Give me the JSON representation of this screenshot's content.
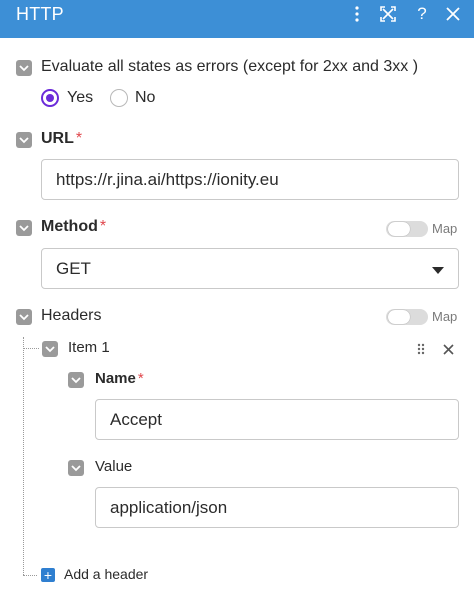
{
  "header": {
    "title": "HTTP",
    "icons": [
      "more-vert-icon",
      "fullscreen-icon",
      "help-icon",
      "close-icon"
    ],
    "color": "#3d8fd6"
  },
  "evaluate": {
    "label": "Evaluate all states as errors (except for 2xx and 3xx )",
    "options": [
      "Yes",
      "No"
    ],
    "selected": "Yes"
  },
  "url": {
    "label": "URL",
    "required": "*",
    "value": "https://r.jina.ai/https://ionity.eu"
  },
  "method": {
    "label": "Method",
    "required": "*",
    "value": "GET",
    "map_label": "Map"
  },
  "headers": {
    "label": "Headers",
    "map_label": "Map",
    "items": [
      {
        "label": "Item 1",
        "name": {
          "label": "Name",
          "required": "*",
          "value": "Accept"
        },
        "value": {
          "label": "Value",
          "value": "application/json"
        }
      }
    ],
    "add_label": "Add a header"
  },
  "colors": {
    "accent": "#6b2bd9",
    "required": "#e0474c",
    "checkbox": "#9a9a9a",
    "add": "#2f7fd0"
  }
}
